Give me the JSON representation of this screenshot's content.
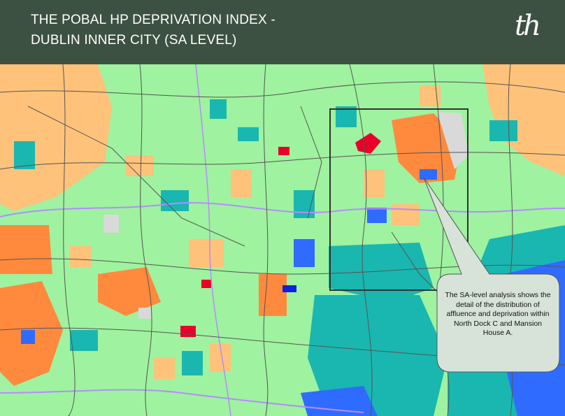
{
  "header": {
    "title_line1": "THE POBAL HP DEPRIVATION INDEX -",
    "title_line2": "DUBLIN INNER CITY (SA LEVEL)",
    "logo": "th",
    "background": "#3d5142"
  },
  "map": {
    "legend_colors": {
      "very_disadvantaged": "#e8002a",
      "disadvantaged": "#ff8a3d",
      "marginally_below_average": "#ffc27a",
      "marginally_above_average": "#9ff29f",
      "affluent": "#19b7b0",
      "very_affluent": "#2f6bff",
      "extremely_affluent": "#1020e0",
      "no_data": "#d9d9d9",
      "boundary": "#b48cff"
    },
    "callout_text": "The SA-level analysis shows the detail of the distribution of affluence and deprivation within North Dock C and Mansion House A."
  }
}
